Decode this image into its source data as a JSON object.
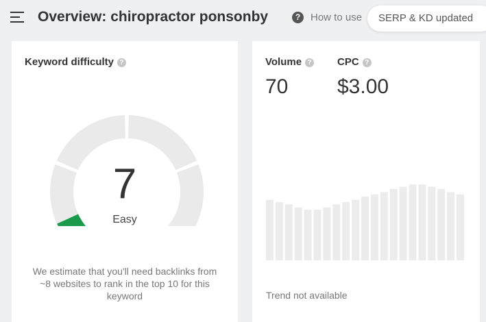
{
  "header": {
    "menu_icon": "hamburger-menu-icon",
    "title": "Overview: chiropractor ponsonby",
    "help_glyph": "?",
    "howto_text": "How to use",
    "serp_badge_text": "SERP & KD updated"
  },
  "kd_card": {
    "title": "Keyword difficulty",
    "value": "7",
    "label": "Easy",
    "estimate": "We estimate that you'll need backlinks from ~8 websites to rank in the top 10 for this keyword",
    "score_fraction": 0.07,
    "gauge_fill_color": "#1a9a4a",
    "gauge_track_color": "#eaeaea"
  },
  "volume_card": {
    "volume_label": "Volume",
    "volume_value": "70",
    "cpc_label": "CPC",
    "cpc_value": "$3.00",
    "trend_text": "Trend not available",
    "trend_bar_color": "#ececec",
    "trend_bars": [
      0.79,
      0.76,
      0.73,
      0.69,
      0.66,
      0.66,
      0.69,
      0.73,
      0.76,
      0.79,
      0.83,
      0.86,
      0.89,
      0.93,
      0.96,
      0.99,
      0.99,
      0.96,
      0.93,
      0.89,
      0.86,
      0.83
    ]
  }
}
